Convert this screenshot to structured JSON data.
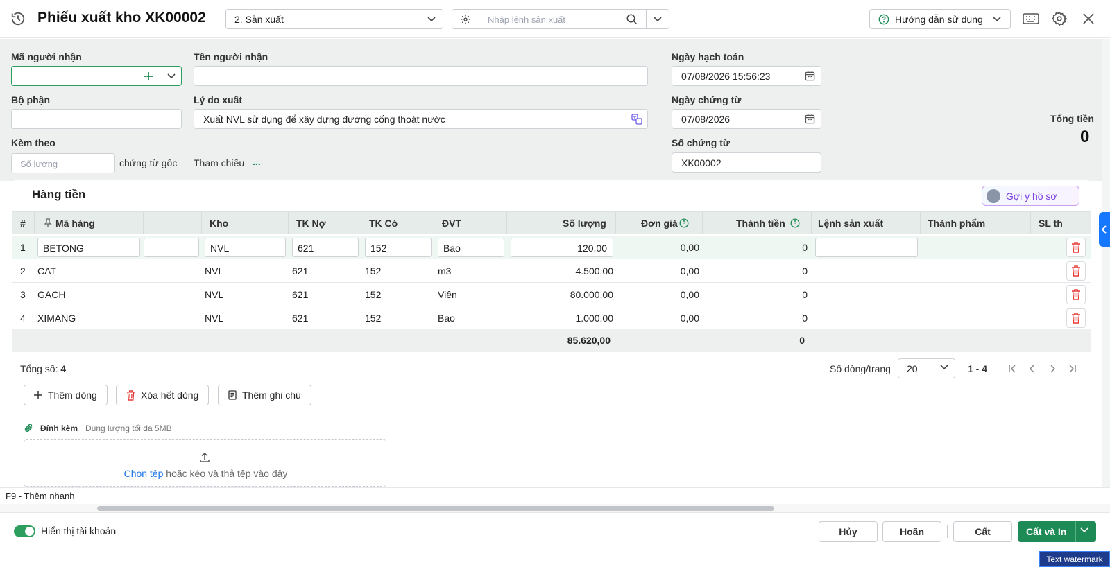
{
  "header": {
    "title": "Phiếu xuất kho XK00002",
    "type_select": "2. Sản xuất",
    "order_placeholder": "Nhập lệnh sản xuất",
    "guide_label": "Hướng dẫn sử dụng"
  },
  "form": {
    "recipient_code_label": "Mã người nhận",
    "recipient_name_label": "Tên người nhận",
    "department_label": "Bộ phận",
    "reason_label": "Lý do xuất",
    "reason_value": "Xuất NVL sử dụng để xây dựng đường cống thoát nước",
    "attach_label": "Kèm theo",
    "attach_placeholder": "Số lượng",
    "attach_suffix": "chứng từ gốc",
    "ref_label": "Tham chiếu",
    "ref_link": "...",
    "posting_date_label": "Ngày hạch toán",
    "posting_date": "07/08/2026 15:56:23",
    "voucher_date_label": "Ngày chứng từ",
    "voucher_date": "07/08/2026",
    "voucher_no_label": "Số chứng từ",
    "voucher_no": "XK00002",
    "total_label": "Tổng tiền",
    "total_value": "0"
  },
  "grid": {
    "title": "Hàng tiền",
    "suggest_label": "Gợi ý hồ sơ",
    "columns": {
      "idx": "#",
      "code": "Mã hàng",
      "warehouse": "Kho",
      "debit": "TK Nợ",
      "credit": "TK Có",
      "unit": "ĐVT",
      "qty": "Số lượng",
      "price": "Đơn giá",
      "amount": "Thành tiền",
      "order": "Lệnh sản xuất",
      "product": "Thành phẩm",
      "sl": "SL th"
    },
    "rows": [
      {
        "idx": "1",
        "code": "BETONG",
        "warehouse": "NVL",
        "debit": "621",
        "credit": "152",
        "unit": "Bao",
        "qty": "120,00",
        "price": "0,00",
        "amount": "0"
      },
      {
        "idx": "2",
        "code": "CAT",
        "warehouse": "NVL",
        "debit": "621",
        "credit": "152",
        "unit": "m3",
        "qty": "4.500,00",
        "price": "0,00",
        "amount": "0"
      },
      {
        "idx": "3",
        "code": "GACH",
        "warehouse": "NVL",
        "debit": "621",
        "credit": "152",
        "unit": "Viên",
        "qty": "80.000,00",
        "price": "0,00",
        "amount": "0"
      },
      {
        "idx": "4",
        "code": "XIMANG",
        "warehouse": "NVL",
        "debit": "621",
        "credit": "152",
        "unit": "Bao",
        "qty": "1.000,00",
        "price": "0,00",
        "amount": "0"
      }
    ],
    "sum_qty": "85.620,00",
    "sum_amount": "0",
    "total_label": "Tổng số:",
    "total_count": "4",
    "per_page_label": "Số dòng/trang",
    "per_page": "20",
    "range": "1 - 4",
    "add_row": "Thêm dòng",
    "clear_rows": "Xóa hết dòng",
    "add_note": "Thêm ghi chú"
  },
  "attachment": {
    "label": "Đính kèm",
    "hint": "Dung lượng tối đa 5MB",
    "choose": "Chọn tệp",
    "drop_text": "hoặc kéo và thả tệp vào đây"
  },
  "shortcut": "F9 - Thêm nhanh",
  "footer": {
    "show_account": "Hiển thị tài khoản",
    "cancel": "Hủy",
    "undo": "Hoãn",
    "save": "Cất",
    "save_print": "Cất và In"
  },
  "watermark": "Text watermark",
  "colors": {
    "primary": "#1e8a55",
    "accent_blue": "#1677ff",
    "delete_red": "#e53935"
  }
}
